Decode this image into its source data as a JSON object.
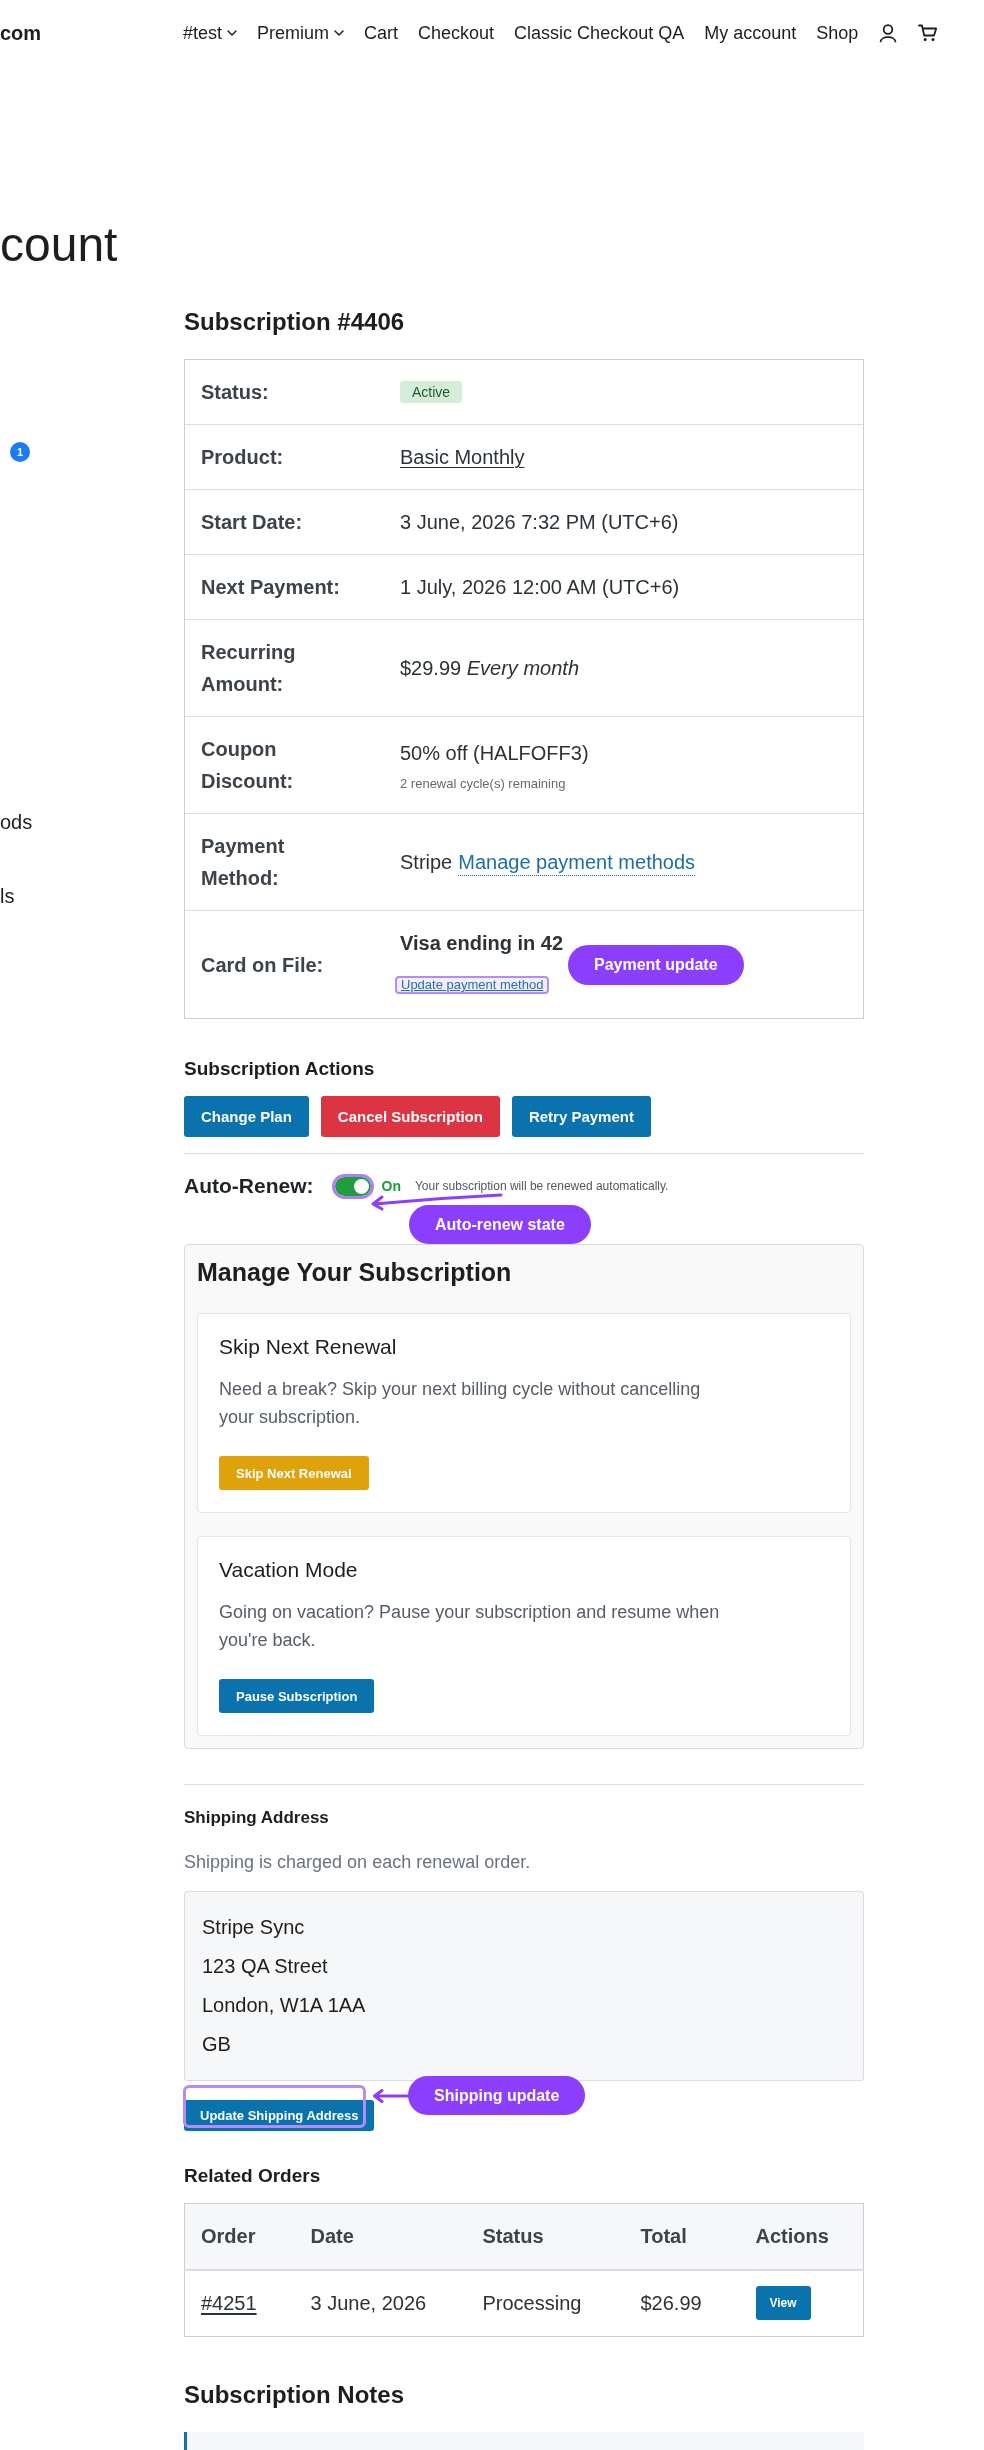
{
  "header": {
    "site_title": "com",
    "nav": [
      {
        "label": "#test",
        "submenu": true
      },
      {
        "label": "Premium",
        "submenu": true
      },
      {
        "label": "Cart",
        "submenu": false
      },
      {
        "label": "Checkout",
        "submenu": false
      },
      {
        "label": "Classic Checkout QA",
        "submenu": false
      },
      {
        "label": "My account",
        "submenu": false
      },
      {
        "label": "Shop",
        "submenu": false
      }
    ]
  },
  "page_title": "count",
  "sidebar": {
    "items": [
      {
        "kind": "badge",
        "badge": "1"
      },
      {
        "kind": "link",
        "label": "ods"
      },
      {
        "kind": "link",
        "label": "ls"
      }
    ]
  },
  "subscription": {
    "title": "Subscription #4406",
    "details": [
      {
        "kind": "status",
        "label": "Status:",
        "value": "Active"
      },
      {
        "kind": "link",
        "label": "Product:",
        "value": "Basic Monthly"
      },
      {
        "kind": "text",
        "label": "Start Date:",
        "value": "3 June, 2026 7:32 PM (UTC+6)"
      },
      {
        "kind": "text",
        "label": "Next Payment:",
        "value": "1 July, 2026 12:00 AM (UTC+6)"
      },
      {
        "kind": "text",
        "label": "Recurring Amount:",
        "value": "$29.99 *Every month*"
      },
      {
        "kind": "coupon",
        "label": "Coupon Discount:",
        "value": "50% off (HALFOFF3)",
        "note": "2 renewal cycle(s) remaining"
      },
      {
        "kind": "payment",
        "label": "Payment Method:",
        "value": "Stripe",
        "link": "Manage payment methods"
      },
      {
        "kind": "card",
        "label": "Card on File:",
        "value": "Visa ending in 42",
        "link": "Update payment method"
      }
    ]
  },
  "actions": {
    "title": "Subscription Actions",
    "buttons": [
      {
        "label": "Change Plan",
        "kind": "primary"
      },
      {
        "label": "Cancel Subscription",
        "kind": "danger"
      },
      {
        "label": "Retry Payment",
        "kind": "primary"
      }
    ]
  },
  "auto_renew": {
    "label": "Auto-Renew:",
    "on": true,
    "state_text": "On",
    "description": "Your subscription will be renewed automatically."
  },
  "manage": {
    "title": "Manage Your Subscription",
    "cards": [
      {
        "title": "Skip Next Renewal",
        "description": "Need a break? Skip your next billing cycle without cancelling your subscription.",
        "button": "Skip Next Renewal",
        "kind": "warning"
      },
      {
        "title": "Vacation Mode",
        "description": "Going on vacation? Pause your subscription and resume when you're back.",
        "button": "Pause Subscription",
        "kind": "primary"
      }
    ]
  },
  "shipping": {
    "title": "Shipping Address",
    "note": "Shipping is charged on each renewal order.",
    "address": [
      "Stripe Sync",
      "123 QA Street",
      "London, W1A 1AA",
      "GB"
    ],
    "button": "Update Shipping Address"
  },
  "related_orders": {
    "title": "Related Orders",
    "columns": [
      "Order",
      "Date",
      "Status",
      "Total",
      "Actions"
    ],
    "rows": [
      {
        "order": "#4251",
        "date": "3 June, 2026",
        "status": "Processing",
        "total": "$26.99",
        "action": "View"
      }
    ]
  },
  "notes": {
    "title": "Subscription Notes"
  },
  "annotations": [
    {
      "kind": "card",
      "label": "Payment update",
      "arrow": false,
      "highlight": true
    },
    {
      "kind": "auto_renew",
      "label": "Auto-renew state",
      "arrow": true,
      "highlight": true
    },
    {
      "kind": "shipping",
      "label": "Shipping update",
      "arrow": true,
      "highlight": true
    }
  ]
}
